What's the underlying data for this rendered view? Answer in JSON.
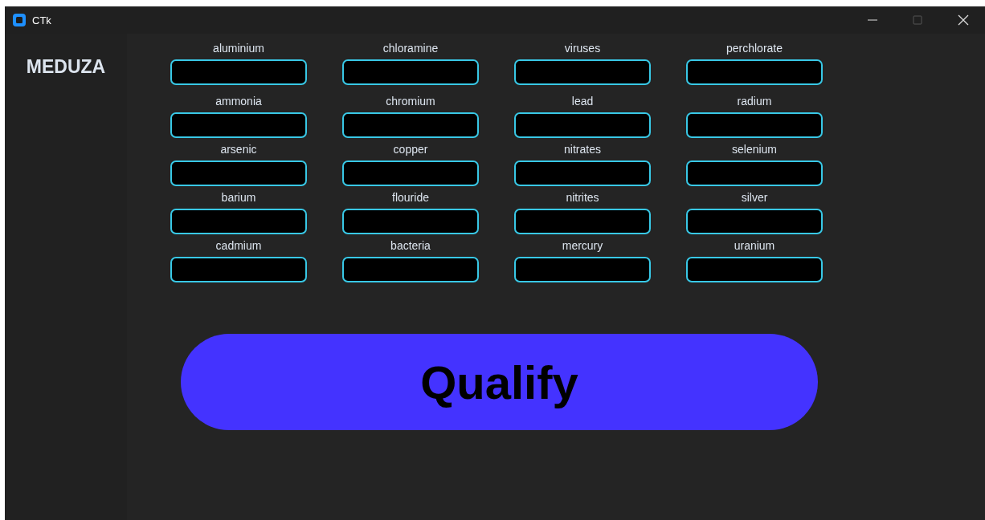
{
  "window": {
    "title": "CTk"
  },
  "sidebar": {
    "title": "MEDUZA"
  },
  "fields": [
    {
      "label": "aluminium"
    },
    {
      "label": "chloramine"
    },
    {
      "label": "viruses"
    },
    {
      "label": "perchlorate"
    },
    {
      "label": "ammonia"
    },
    {
      "label": "chromium"
    },
    {
      "label": "lead"
    },
    {
      "label": "radium"
    },
    {
      "label": "arsenic"
    },
    {
      "label": "copper"
    },
    {
      "label": "nitrates"
    },
    {
      "label": "selenium"
    },
    {
      "label": "barium"
    },
    {
      "label": "flouride"
    },
    {
      "label": "nitrites"
    },
    {
      "label": "silver"
    },
    {
      "label": "cadmium"
    },
    {
      "label": "bacteria"
    },
    {
      "label": "mercury"
    },
    {
      "label": "uranium"
    }
  ],
  "button": {
    "label": "Qualify"
  }
}
